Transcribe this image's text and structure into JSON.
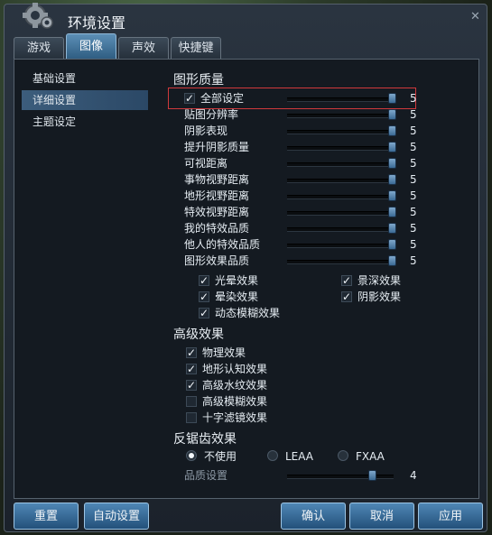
{
  "window": {
    "title": "环境设置",
    "close_glyph": "✕"
  },
  "tabs": [
    {
      "label": "游戏",
      "active": false
    },
    {
      "label": "图像",
      "active": true
    },
    {
      "label": "声效",
      "active": false
    },
    {
      "label": "快捷键",
      "active": false
    }
  ],
  "sidebar": {
    "items": [
      {
        "label": "基础设置",
        "active": false
      },
      {
        "label": "详细设置",
        "active": true
      },
      {
        "label": "主题设定",
        "active": false
      }
    ]
  },
  "graphics_quality": {
    "title": "图形质量",
    "all_settings": {
      "label": "全部设定",
      "checked": true,
      "value": "5",
      "level": 1.0
    },
    "sliders": [
      {
        "label": "贴图分辨率",
        "value": "5",
        "level": 1.0
      },
      {
        "label": "阴影表现",
        "value": "5",
        "level": 1.0
      },
      {
        "label": "提升阴影质量",
        "value": "5",
        "level": 1.0
      },
      {
        "label": "可视距离",
        "value": "5",
        "level": 1.0
      },
      {
        "label": "事物视野距离",
        "value": "5",
        "level": 1.0
      },
      {
        "label": "地形视野距离",
        "value": "5",
        "level": 1.0
      },
      {
        "label": "特效视野距离",
        "value": "5",
        "level": 1.0
      },
      {
        "label": "我的特效品质",
        "value": "5",
        "level": 1.0
      },
      {
        "label": "他人的特效品质",
        "value": "5",
        "level": 1.0
      },
      {
        "label": "图形效果品质",
        "value": "5",
        "level": 1.0
      }
    ],
    "effects": [
      {
        "label": "光晕效果",
        "checked": true
      },
      {
        "label": "景深效果",
        "checked": true
      },
      {
        "label": "晕染效果",
        "checked": true
      },
      {
        "label": "阴影效果",
        "checked": true
      },
      {
        "label": "动态模糊效果",
        "checked": true
      }
    ]
  },
  "advanced": {
    "title": "高级效果",
    "items": [
      {
        "label": "物理效果",
        "checked": true
      },
      {
        "label": "地形认知效果",
        "checked": true
      },
      {
        "label": "高级水纹效果",
        "checked": true
      },
      {
        "label": "高级模糊效果",
        "checked": false
      },
      {
        "label": "十字滤镜效果",
        "checked": false
      }
    ]
  },
  "antialias": {
    "title": "反锯齿效果",
    "options": [
      {
        "label": "不使用",
        "selected": true
      },
      {
        "label": "LEAA",
        "selected": false
      },
      {
        "label": "FXAA",
        "selected": false
      }
    ],
    "quality": {
      "label": "品质设置",
      "value": "4",
      "level": 0.8
    }
  },
  "buttons": {
    "reset": "重置",
    "auto": "自动设置",
    "confirm": "确认",
    "cancel": "取消",
    "apply": "应用"
  },
  "colors": {
    "accent": "#3b6a95",
    "highlight": "#d0393c"
  }
}
